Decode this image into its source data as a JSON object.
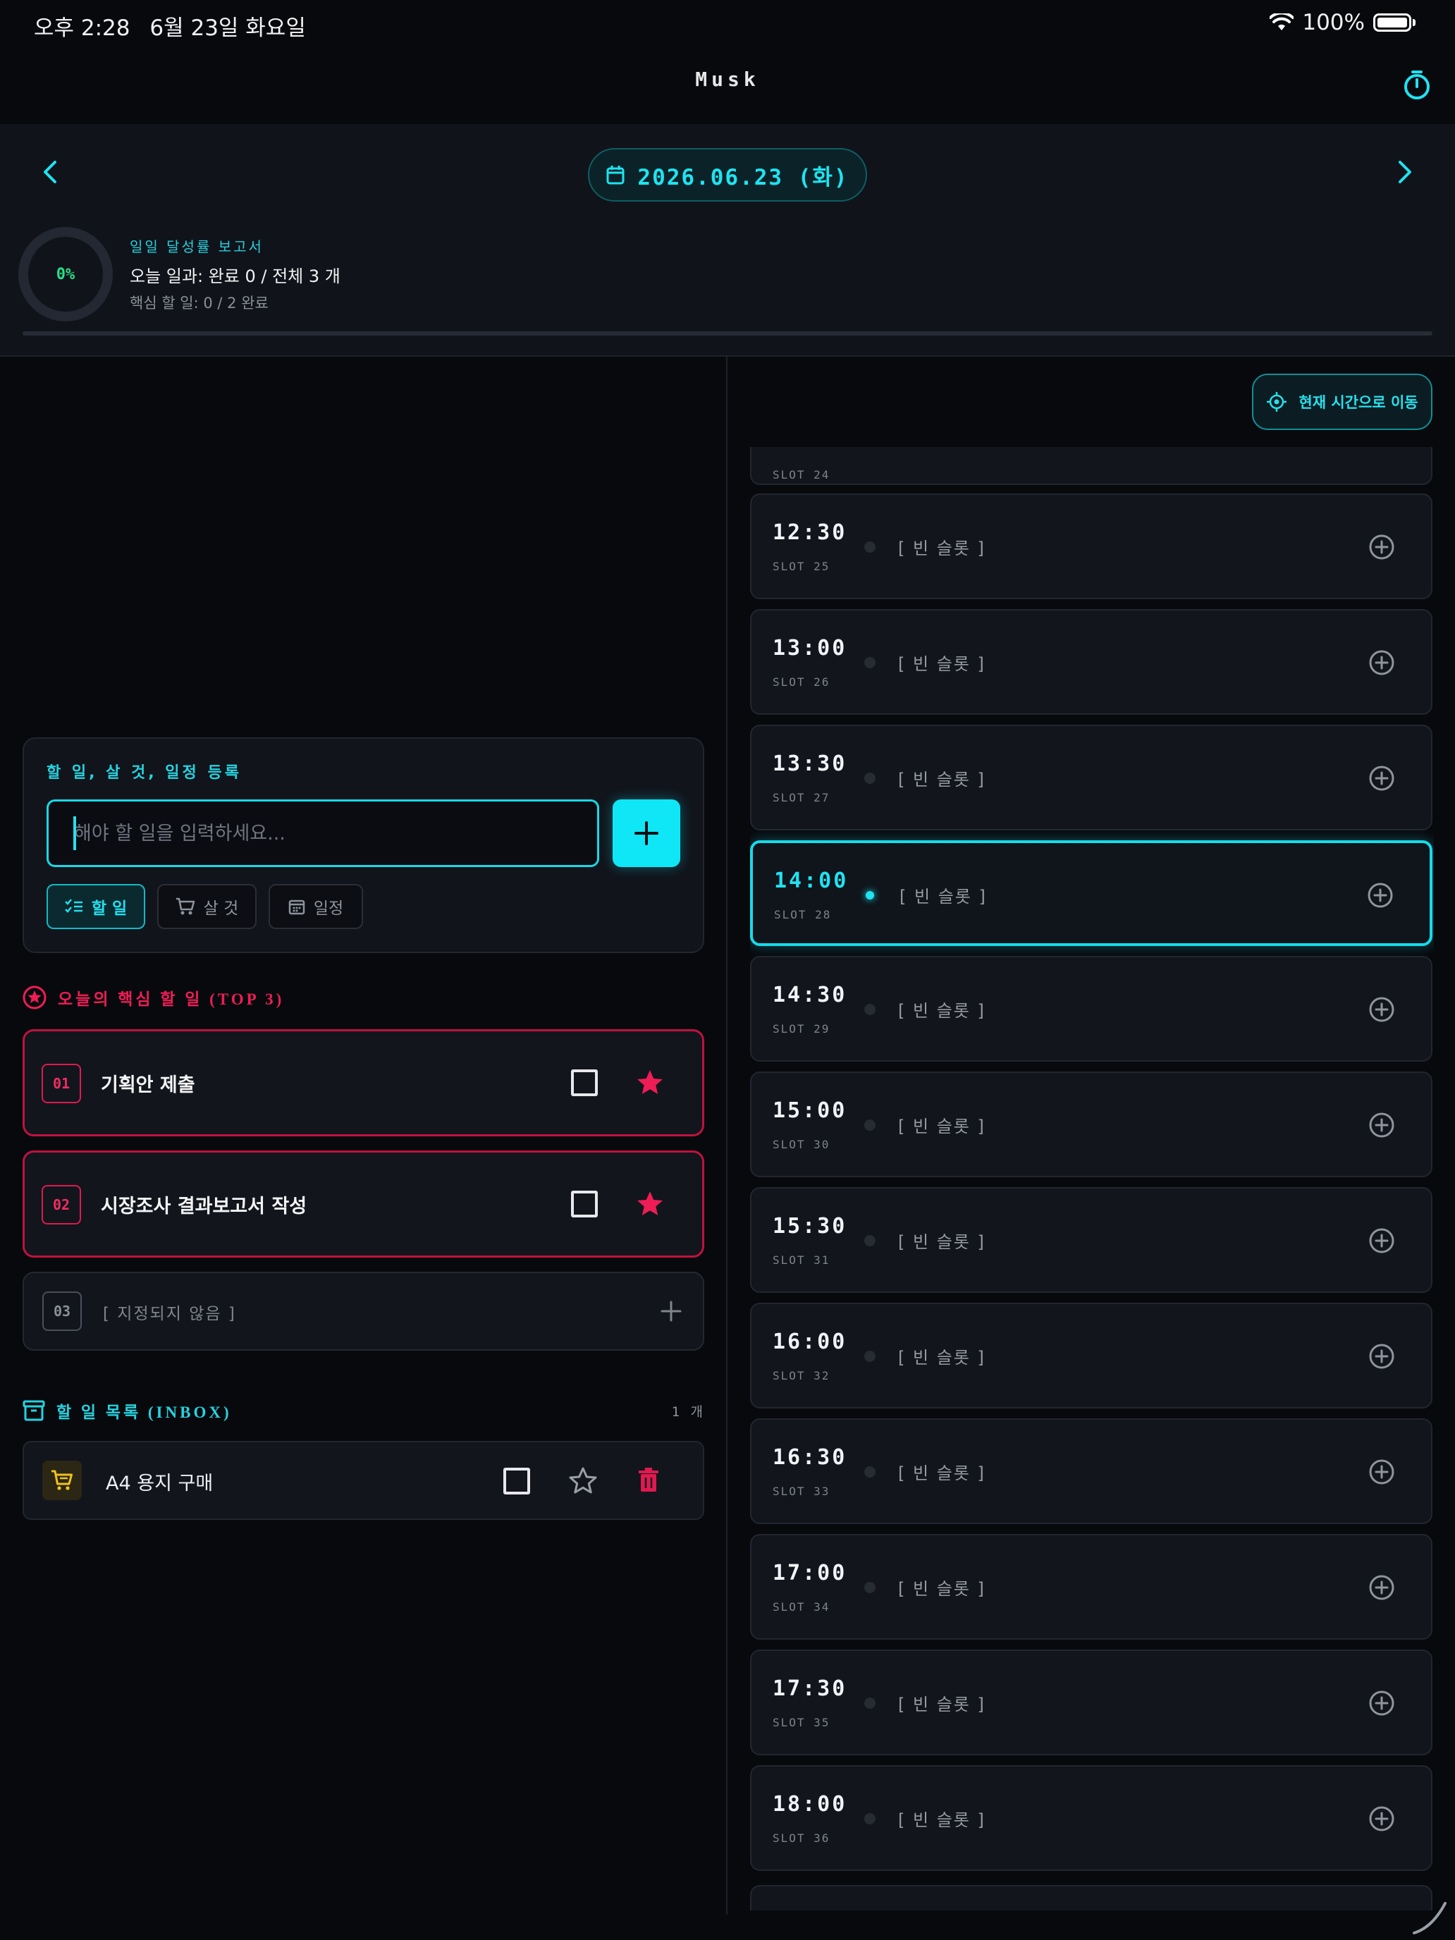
{
  "status_bar": {
    "time": "오후 2:28",
    "date": "6월 23일 화요일",
    "battery": "100%"
  },
  "app": {
    "title": "Musk"
  },
  "header": {
    "date": "2026.06.23 (화)",
    "report_title": "일일 달성률 보고서",
    "percent": "0%",
    "progress_fraction": 0,
    "summary": "오늘 일과: 완료 0 / 전체 3 개",
    "core_summary": "핵심 할 일: 0 / 2 완료"
  },
  "input": {
    "title": "할 일, 살 것, 일정 등록",
    "placeholder": "해야 할 일을 입력하세요...",
    "value": "",
    "types": [
      {
        "label": "할 일",
        "selected": true
      },
      {
        "label": "살 것",
        "selected": false
      },
      {
        "label": "일정",
        "selected": false
      }
    ]
  },
  "top3": {
    "heading": "오늘의 핵심 할 일 (TOP 3)",
    "items": [
      {
        "rank": "01",
        "title": "기획안 제출",
        "starred": true
      },
      {
        "rank": "02",
        "title": "시장조사 결과보고서 작성",
        "starred": true
      },
      {
        "rank": "03",
        "title": "[ 지정되지 않음 ]",
        "starred": false
      }
    ]
  },
  "inbox": {
    "heading": "할 일 목록 (INBOX)",
    "count": "1 개",
    "items": [
      {
        "title": "A4 용지 구매",
        "type": "shopping-cart-icon"
      }
    ]
  },
  "timeline": {
    "now_button": "현재 시간으로 이동",
    "partial_top_label": "SLOT 24",
    "empty_label": "[ 빈 슬롯 ]",
    "slots": [
      {
        "time": "12:30",
        "label": "SLOT 25"
      },
      {
        "time": "13:00",
        "label": "SLOT 26"
      },
      {
        "time": "13:30",
        "label": "SLOT 27"
      },
      {
        "time": "14:00",
        "label": "SLOT 28",
        "current": true
      },
      {
        "time": "14:30",
        "label": "SLOT 29"
      },
      {
        "time": "15:00",
        "label": "SLOT 30"
      },
      {
        "time": "15:30",
        "label": "SLOT 31"
      },
      {
        "time": "16:00",
        "label": "SLOT 32"
      },
      {
        "time": "16:30",
        "label": "SLOT 33"
      },
      {
        "time": "17:00",
        "label": "SLOT 34"
      },
      {
        "time": "17:30",
        "label": "SLOT 35"
      },
      {
        "time": "18:00",
        "label": "SLOT 36"
      }
    ]
  },
  "colors": {
    "accent": "#16dbea",
    "danger": "#e0194f",
    "success": "#28e089",
    "background": "#08090d"
  }
}
